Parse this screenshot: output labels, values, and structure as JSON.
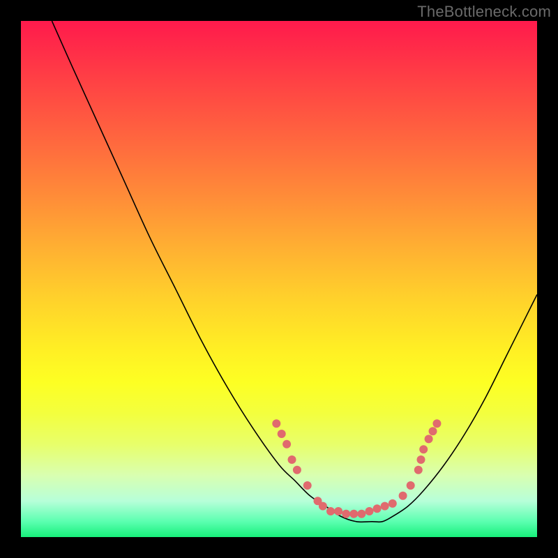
{
  "watermark": "TheBottleneck.com",
  "colors": {
    "background": "#000000",
    "dot": "#e06a6e",
    "curve": "#000000",
    "watermark": "#6a6a6a"
  },
  "chart_data": {
    "type": "line",
    "title": "",
    "xlabel": "",
    "ylabel": "",
    "xlim": [
      0,
      100
    ],
    "ylim": [
      0,
      100
    ],
    "grid": false,
    "legend": false,
    "series": [
      {
        "name": "bottleneck-curve",
        "x": [
          6,
          10,
          15,
          20,
          25,
          30,
          35,
          40,
          45,
          50,
          53,
          56,
          59,
          62,
          65,
          68,
          70,
          72,
          75,
          78,
          82,
          86,
          90,
          94,
          98,
          100
        ],
        "y": [
          100,
          91,
          80,
          69,
          58,
          48,
          38,
          29,
          21,
          14,
          11,
          8,
          6,
          4,
          3,
          3,
          3,
          4,
          6,
          9,
          14,
          20,
          27,
          35,
          43,
          47
        ]
      }
    ],
    "markers": {
      "note": "salmon dots overlaid near the curve minimum; left cluster on descending arm, right cluster on ascending arm, dense bottom run",
      "points": [
        {
          "x": 49.5,
          "y": 22
        },
        {
          "x": 50.5,
          "y": 20
        },
        {
          "x": 51.5,
          "y": 18
        },
        {
          "x": 52.5,
          "y": 15
        },
        {
          "x": 53.5,
          "y": 13
        },
        {
          "x": 55.5,
          "y": 10
        },
        {
          "x": 57.5,
          "y": 7
        },
        {
          "x": 58.5,
          "y": 6
        },
        {
          "x": 60,
          "y": 5
        },
        {
          "x": 61.5,
          "y": 5
        },
        {
          "x": 63,
          "y": 4.5
        },
        {
          "x": 64.5,
          "y": 4.5
        },
        {
          "x": 66,
          "y": 4.5
        },
        {
          "x": 67.5,
          "y": 5
        },
        {
          "x": 69,
          "y": 5.5
        },
        {
          "x": 70.5,
          "y": 6
        },
        {
          "x": 72,
          "y": 6.5
        },
        {
          "x": 74,
          "y": 8
        },
        {
          "x": 75.5,
          "y": 10
        },
        {
          "x": 77,
          "y": 13
        },
        {
          "x": 77.5,
          "y": 15
        },
        {
          "x": 78,
          "y": 17
        },
        {
          "x": 79,
          "y": 19
        },
        {
          "x": 79.8,
          "y": 20.5
        },
        {
          "x": 80.6,
          "y": 22
        }
      ]
    }
  }
}
